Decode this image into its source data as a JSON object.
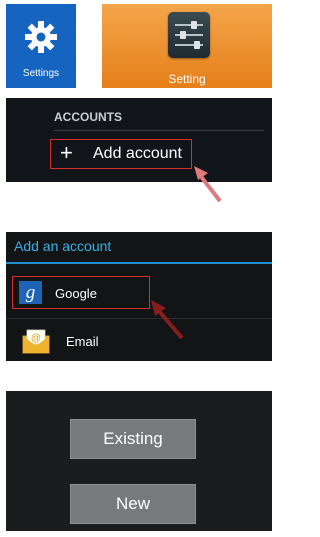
{
  "tiles": {
    "settings_label": "Settings",
    "setting_label": "Setting"
  },
  "accounts": {
    "header": "ACCOUNTS",
    "add_account": "Add account",
    "plus_glyph": "+"
  },
  "add_account_dialog": {
    "title": "Add an account",
    "options": [
      {
        "label": "Google",
        "icon": "google-g-icon",
        "icon_glyph": "g"
      },
      {
        "label": "Email",
        "icon": "email-envelope-icon"
      }
    ]
  },
  "account_choice": {
    "existing_label": "Existing",
    "new_label": "New"
  },
  "colors": {
    "metro_blue": "#1565c0",
    "orange_tile": "#e57f1a",
    "dark_panel": "#111418",
    "highlight_red": "#d32f2f",
    "holo_blue": "#39b0e3",
    "arrow_red": "#c62828"
  }
}
